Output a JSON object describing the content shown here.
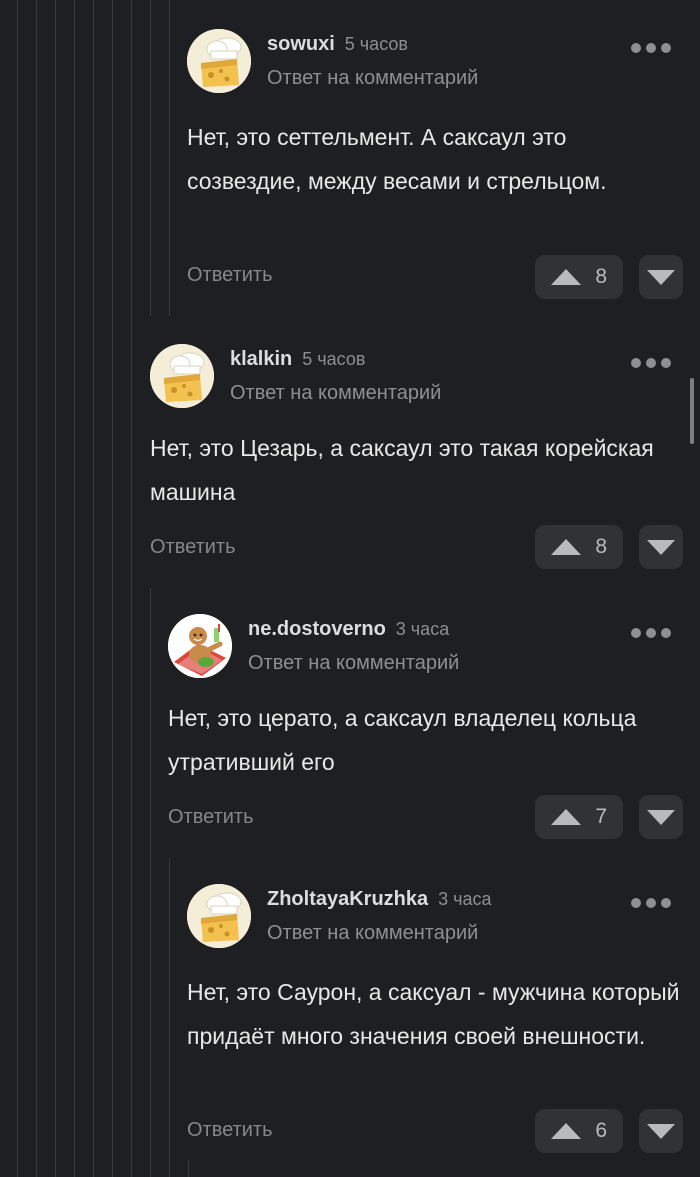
{
  "comments": [
    {
      "username": "sowuxi",
      "time": "5 часов",
      "reply_to": "Ответ на комментарий",
      "text": "Нет, это сеттельмент. А саксаул это созвездие, между весами и стрельцом.",
      "reply_label": "Ответить",
      "votes": "8",
      "avatar": "baker-cheese-avatar"
    },
    {
      "username": "klalkin",
      "time": "5 часов",
      "reply_to": "Ответ на комментарий",
      "text": "Нет, это Цезарь, а саксаул это такая корейская машина",
      "reply_label": "Ответить",
      "votes": "8",
      "avatar": "baker-cheese-avatar"
    },
    {
      "username": "ne.dostoverno",
      "time": "3 часа",
      "reply_to": "Ответ на комментарий",
      "text": "Нет, это церато, а саксаул владелец кольца утративший его",
      "reply_label": "Ответить",
      "votes": "7",
      "avatar": "gingerbread-deckchair-avatar"
    },
    {
      "username": "ZholtayaKruzhka",
      "time": "3 часа",
      "reply_to": "Ответ на комментарий",
      "text": "Нет, это Саурон, а саксуал - мужчина который придаёт много значения своей внешности.",
      "reply_label": "Ответить",
      "votes": "6",
      "avatar": "baker-cheese-avatar"
    }
  ],
  "icons": {
    "more": "more-dots-icon",
    "upvote": "upvote-arrow-icon",
    "downvote": "downvote-arrow-icon"
  },
  "colors": {
    "background": "#1e1f22",
    "button_bg": "#313236",
    "muted_text": "#8d8f95"
  }
}
